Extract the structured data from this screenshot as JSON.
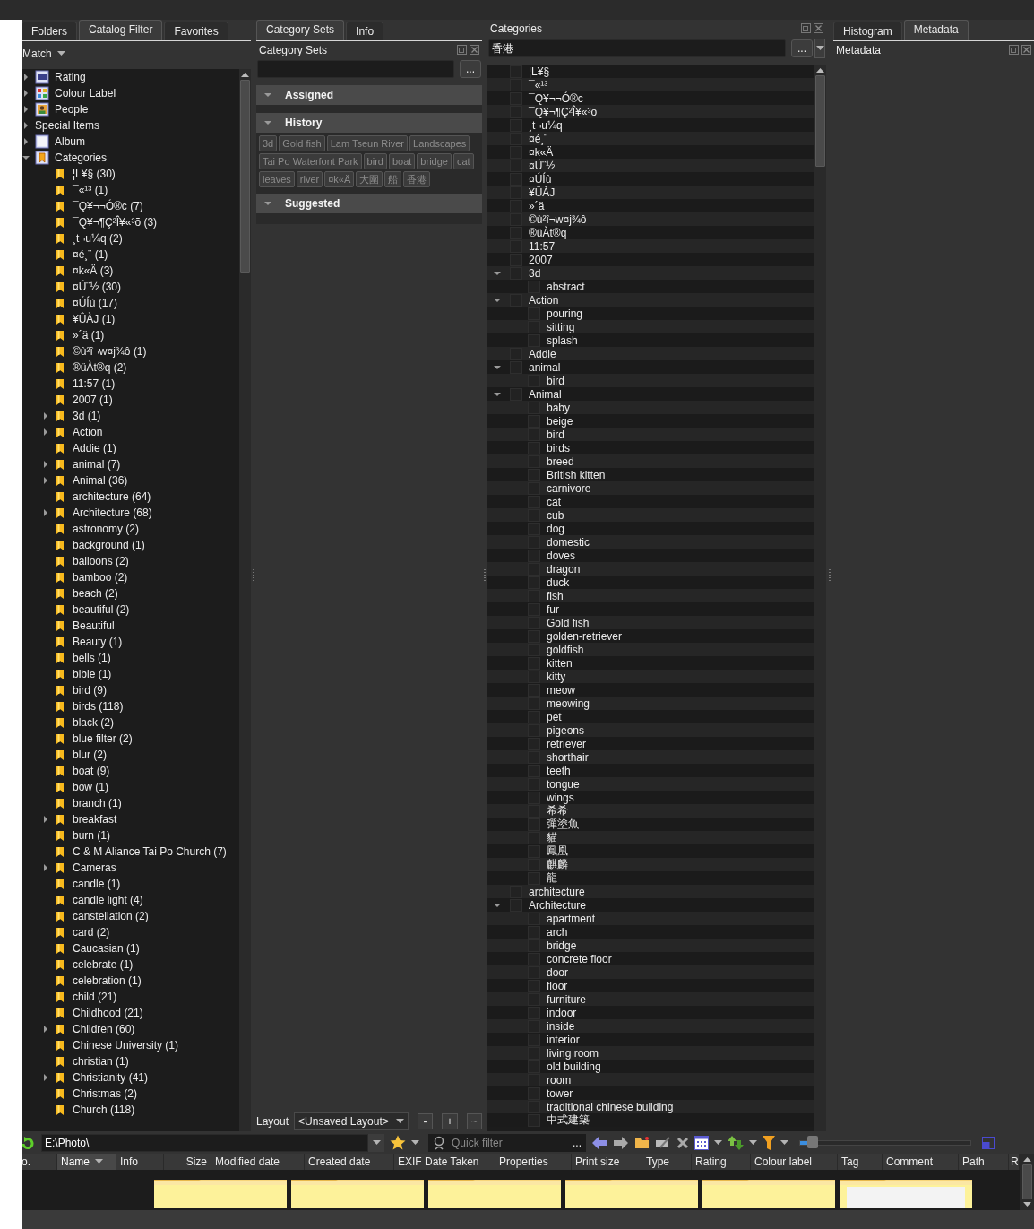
{
  "catalog_panel": {
    "tabs": [
      {
        "label": "Folders",
        "selected": false
      },
      {
        "label": "Catalog Filter",
        "selected": true
      },
      {
        "label": "Favorites",
        "selected": false
      }
    ],
    "match": "Match",
    "tree": [
      {
        "label": "Rating",
        "kind": "rating",
        "expanded": false
      },
      {
        "label": "Colour Label",
        "kind": "colour",
        "expanded": false
      },
      {
        "label": "People",
        "kind": "people",
        "expanded": false
      },
      {
        "label": "Special Items",
        "kind": "plain",
        "expanded": false
      },
      {
        "label": "Album",
        "kind": "album",
        "expanded": false
      },
      {
        "label": "Categories",
        "kind": "categories",
        "expanded": true,
        "children": [
          {
            "label": "¦L¥§ (30)"
          },
          {
            "label": "¯«¹³ (1)"
          },
          {
            "label": "¯Q¥¬¬Ó®c (7)"
          },
          {
            "label": "¯Q¥¬¶Ç²Î¥«³õ (3)"
          },
          {
            "label": "¸t¬u¼q (2)"
          },
          {
            "label": "¤é¸¨ (1)"
          },
          {
            "label": "¤k«Ä (3)"
          },
          {
            "label": "¤Ú¨½ (30)"
          },
          {
            "label": "¤ÚÍù (17)"
          },
          {
            "label": "¥ÛÀJ (1)"
          },
          {
            "label": "»´ä (1)"
          },
          {
            "label": "©ù²î¬w¤j¾ô (1)"
          },
          {
            "label": "®üÀt®q (2)"
          },
          {
            "label": "11:57 (1)"
          },
          {
            "label": "2007 (1)"
          },
          {
            "label": "3d (1)",
            "expanded": false
          },
          {
            "label": "Action",
            "expanded": false
          },
          {
            "label": "Addie (1)"
          },
          {
            "label": "animal (7)",
            "expanded": false
          },
          {
            "label": "Animal (36)",
            "expanded": false
          },
          {
            "label": "architecture (64)"
          },
          {
            "label": "Architecture (68)",
            "expanded": false
          },
          {
            "label": "astronomy (2)"
          },
          {
            "label": "background (1)"
          },
          {
            "label": "balloons (2)"
          },
          {
            "label": "bamboo (2)"
          },
          {
            "label": "beach (2)"
          },
          {
            "label": "beautiful (2)"
          },
          {
            "label": "Beautiful"
          },
          {
            "label": "Beauty (1)"
          },
          {
            "label": "bells (1)"
          },
          {
            "label": "bible (1)"
          },
          {
            "label": "bird (9)"
          },
          {
            "label": "birds (118)"
          },
          {
            "label": "black (2)"
          },
          {
            "label": "blue filter (2)"
          },
          {
            "label": "blur (2)"
          },
          {
            "label": "boat (9)"
          },
          {
            "label": "bow (1)"
          },
          {
            "label": "branch (1)"
          },
          {
            "label": "breakfast",
            "expanded": false
          },
          {
            "label": "burn (1)"
          },
          {
            "label": "C & M Aliance Tai Po Church (7)"
          },
          {
            "label": "Cameras",
            "expanded": false
          },
          {
            "label": "candle (1)"
          },
          {
            "label": "candle light (4)"
          },
          {
            "label": "canstellation (2)"
          },
          {
            "label": "card (2)"
          },
          {
            "label": "Caucasian (1)"
          },
          {
            "label": "celebrate (1)"
          },
          {
            "label": "celebration (1)"
          },
          {
            "label": "child (21)"
          },
          {
            "label": "Childhood (21)"
          },
          {
            "label": "Children (60)",
            "expanded": false
          },
          {
            "label": "Chinese University (1)"
          },
          {
            "label": "christian (1)"
          },
          {
            "label": "Christianity (41)",
            "expanded": false
          },
          {
            "label": "Christmas (2)"
          },
          {
            "label": "Church (118)"
          }
        ]
      }
    ]
  },
  "category_sets_panel": {
    "tabs": [
      {
        "label": "Category Sets",
        "selected": true
      },
      {
        "label": "Info",
        "selected": false
      }
    ],
    "title": "Category Sets",
    "more_button": "...",
    "sections": [
      {
        "title": "Assigned",
        "expanded": true
      },
      {
        "title": "History",
        "expanded": true,
        "tags": [
          "3d",
          "Gold fish",
          "Lam Tseun River",
          "Landscapes",
          "Tai Po Waterfont Park",
          "bird",
          "boat",
          "bridge",
          "cat",
          "leaves",
          "river",
          "¤k«Ä",
          "大圍",
          "船",
          "香港"
        ]
      },
      {
        "title": "Suggested",
        "expanded": true
      }
    ],
    "layout": {
      "label": "Layout",
      "value": "<Unsaved Layout>",
      "buttons": [
        {
          "label": "-",
          "disabled": false
        },
        {
          "label": "+",
          "disabled": false
        },
        {
          "label": "~",
          "disabled": true
        }
      ]
    }
  },
  "categories_panel": {
    "title": "Categories",
    "search": {
      "value": "香港"
    },
    "more_button": "...",
    "tree": [
      {
        "label": "¦L¥§",
        "checked": false
      },
      {
        "label": "¯«¹³",
        "checked": false
      },
      {
        "label": "¯Q¥¬¬Ó®c",
        "checked": false
      },
      {
        "label": "¯Q¥¬¶Ç²Î¥«³õ",
        "checked": false
      },
      {
        "label": "¸t¬u¼q",
        "checked": false
      },
      {
        "label": "¤é¸¨",
        "checked": false
      },
      {
        "label": "¤k«Ä",
        "checked": false
      },
      {
        "label": "¤Ú¨½",
        "checked": false
      },
      {
        "label": "¤ÚÍù",
        "checked": false
      },
      {
        "label": "¥ÛÀJ",
        "checked": false
      },
      {
        "label": "»´ä",
        "checked": false
      },
      {
        "label": "©ù²î¬w¤j¾ô",
        "checked": false
      },
      {
        "label": "®üÀt®q",
        "checked": false
      },
      {
        "label": "11:57",
        "checked": false
      },
      {
        "label": "2007",
        "checked": false
      },
      {
        "label": "3d",
        "checked": false,
        "expanded": true,
        "children": [
          {
            "label": "abstract",
            "checked": false
          }
        ]
      },
      {
        "label": "Action",
        "checked": false,
        "expanded": true,
        "children": [
          {
            "label": "pouring",
            "checked": false
          },
          {
            "label": "sitting",
            "checked": false
          },
          {
            "label": "splash",
            "checked": false
          }
        ]
      },
      {
        "label": "Addie",
        "checked": false
      },
      {
        "label": "animal",
        "checked": false,
        "expanded": true,
        "children": [
          {
            "label": "bird",
            "checked": false
          }
        ]
      },
      {
        "label": "Animal",
        "checked": false,
        "expanded": true,
        "children": [
          {
            "label": "baby",
            "checked": false
          },
          {
            "label": "beige",
            "checked": false
          },
          {
            "label": "bird",
            "checked": false
          },
          {
            "label": "birds",
            "checked": false
          },
          {
            "label": "breed",
            "checked": false
          },
          {
            "label": "British kitten",
            "checked": false
          },
          {
            "label": "carnivore",
            "checked": false
          },
          {
            "label": "cat",
            "checked": false
          },
          {
            "label": "cub",
            "checked": false
          },
          {
            "label": "dog",
            "checked": false
          },
          {
            "label": "domestic",
            "checked": false
          },
          {
            "label": "doves",
            "checked": false
          },
          {
            "label": "dragon",
            "checked": false
          },
          {
            "label": "duck",
            "checked": false
          },
          {
            "label": "fish",
            "checked": false
          },
          {
            "label": "fur",
            "checked": false
          },
          {
            "label": "Gold fish",
            "checked": false
          },
          {
            "label": "golden-retriever",
            "checked": false
          },
          {
            "label": "goldfish",
            "checked": false
          },
          {
            "label": "kitten",
            "checked": false
          },
          {
            "label": "kitty",
            "checked": false
          },
          {
            "label": "meow",
            "checked": false
          },
          {
            "label": "meowing",
            "checked": false
          },
          {
            "label": "pet",
            "checked": false
          },
          {
            "label": "pigeons",
            "checked": false
          },
          {
            "label": "retriever",
            "checked": false
          },
          {
            "label": "shorthair",
            "checked": false
          },
          {
            "label": "teeth",
            "checked": false
          },
          {
            "label": "tongue",
            "checked": false
          },
          {
            "label": "wings",
            "checked": false
          },
          {
            "label": "希希",
            "checked": false
          },
          {
            "label": "彈塗魚",
            "checked": false
          },
          {
            "label": "貓",
            "checked": false
          },
          {
            "label": "鳳凰",
            "checked": false
          },
          {
            "label": "麒麟",
            "checked": false
          },
          {
            "label": "龍",
            "checked": false
          }
        ]
      },
      {
        "label": "architecture",
        "checked": false
      },
      {
        "label": "Architecture",
        "checked": false,
        "expanded": true,
        "children": [
          {
            "label": "apartment",
            "checked": false
          },
          {
            "label": "arch",
            "checked": false
          },
          {
            "label": "bridge",
            "checked": false
          },
          {
            "label": "concrete floor",
            "checked": false
          },
          {
            "label": "door",
            "checked": false
          },
          {
            "label": "floor",
            "checked": false
          },
          {
            "label": "furniture",
            "checked": false
          },
          {
            "label": "indoor",
            "checked": false
          },
          {
            "label": "inside",
            "checked": false
          },
          {
            "label": "interior",
            "checked": false
          },
          {
            "label": "living room",
            "checked": false
          },
          {
            "label": "old building",
            "checked": false
          },
          {
            "label": "room",
            "checked": false
          },
          {
            "label": "tower",
            "checked": false
          },
          {
            "label": "traditional chinese building",
            "checked": false
          },
          {
            "label": "中式建築",
            "checked": false
          }
        ]
      }
    ]
  },
  "metadata_panel": {
    "tabs": [
      {
        "label": "Histogram",
        "selected": false
      },
      {
        "label": "Metadata",
        "selected": true
      }
    ],
    "title": "Metadata"
  },
  "file_browser": {
    "address": {
      "value": "E:\\Photo\\"
    },
    "quick_filter": {
      "placeholder": "Quick filter"
    },
    "filter_more": "...",
    "thumb_size": {
      "level": 0.05
    },
    "columns": [
      {
        "label": "o.",
        "sorted": false
      },
      {
        "label": "Name",
        "sorted": true
      },
      {
        "label": "Info",
        "sorted": false
      },
      {
        "label": "Size",
        "sorted": false
      },
      {
        "label": "Modified date",
        "sorted": false
      },
      {
        "label": "Created date",
        "sorted": false
      },
      {
        "label": "EXIF Date Taken",
        "sorted": false
      },
      {
        "label": "Properties",
        "sorted": false
      },
      {
        "label": "Print size",
        "sorted": false
      },
      {
        "label": "Type",
        "sorted": false
      },
      {
        "label": "Rating",
        "sorted": false
      },
      {
        "label": "Colour label",
        "sorted": false
      },
      {
        "label": "Tag",
        "sorted": false
      },
      {
        "label": "Comment",
        "sorted": false
      },
      {
        "label": "Path",
        "sorted": false
      },
      {
        "label": "R",
        "sorted": false
      }
    ],
    "items": [
      {
        "kind": "folder"
      },
      {
        "kind": "folder"
      },
      {
        "kind": "folder"
      },
      {
        "kind": "folder"
      },
      {
        "kind": "folder"
      },
      {
        "kind": "folder-document"
      }
    ]
  }
}
